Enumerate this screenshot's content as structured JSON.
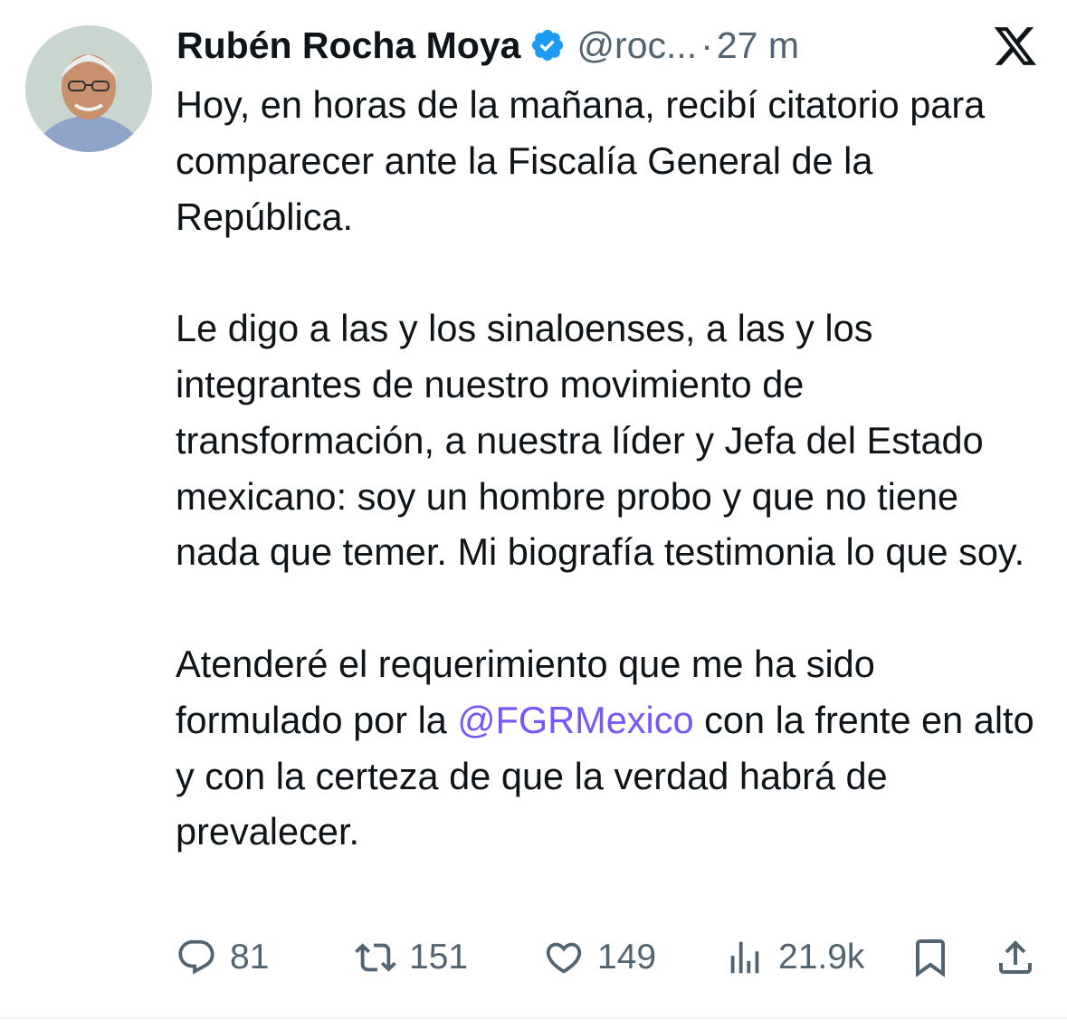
{
  "author": {
    "name": "Rubén Rocha Moya",
    "handle": "@roc...",
    "separator": "·",
    "time": "27 m",
    "verified": true
  },
  "app": {
    "logo_icon": "x-logo-icon"
  },
  "tweet": {
    "paragraph1": "Hoy, en horas de la mañana, recibí citatorio para comparecer ante la Fiscalía General de la República.",
    "paragraph2": "Le digo a las y los sinaloenses, a las y los integrantes de nuestro movimiento de transformación, a nuestra líder y Jefa del Estado mexicano: soy un hombre probo y que no tiene nada que temer. Mi biografía testimonia lo que soy.",
    "paragraph3_before": "Atenderé el requerimiento que me ha sido formulado por la ",
    "paragraph3_mention": "@FGRMexico",
    "paragraph3_after": " con la frente en alto y con la certeza de que la verdad habrá de prevalecer."
  },
  "actions": {
    "replies": "81",
    "reposts": "151",
    "likes": "149",
    "views": "21.9k",
    "reply_icon": "reply-icon",
    "repost_icon": "repost-icon",
    "like_icon": "heart-icon",
    "views_icon": "views-icon",
    "bookmark_icon": "bookmark-icon",
    "share_icon": "share-icon"
  },
  "colors": {
    "text": "#0f1419",
    "secondary": "#536471",
    "mention": "#7856ff",
    "verified": "#1d9bf0"
  }
}
